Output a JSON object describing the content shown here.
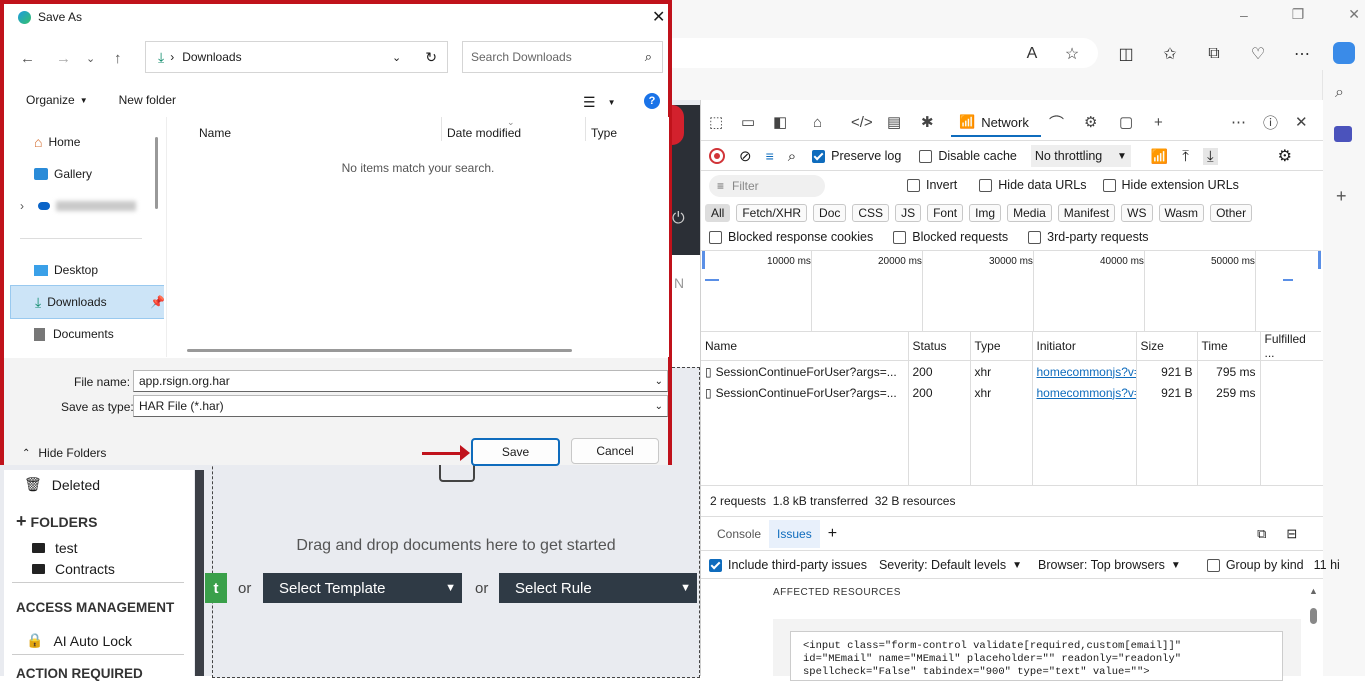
{
  "browser": {
    "toolbar_icons": [
      "read-aloud-icon",
      "favorite-star-icon",
      "split-screen-icon",
      "favorites-icon",
      "collections-icon",
      "browser-essentials-icon",
      "more-icon",
      "copilot-icon"
    ],
    "window_controls": {
      "minimize": "–",
      "restore": "❐",
      "close": "✕"
    }
  },
  "page": {
    "nav": {
      "deleted": "Deleted",
      "folders_header": "FOLDERS",
      "folders": [
        "test",
        "Contracts"
      ],
      "access_header": "ACCESS MANAGEMENT",
      "access_item": "AI Auto Lock",
      "action_header": "ACTION REQUIRED"
    },
    "drop_text": "Drag and drop documents here to get started",
    "or1": "or",
    "or2": "or",
    "select_template": "Select Template",
    "select_rule": "Select Rule",
    "green_btn_partial": "t"
  },
  "devtools": {
    "tabs": {
      "network": "Network"
    },
    "controls": {
      "preserve_log": "Preserve log",
      "disable_cache": "Disable cache",
      "throttling": "No throttling"
    },
    "filter": {
      "placeholder": "Filter",
      "invert": "Invert",
      "hide_data_urls": "Hide data URLs",
      "hide_extension_urls": "Hide extension URLs"
    },
    "type_filters": [
      "All",
      "Fetch/XHR",
      "Doc",
      "CSS",
      "JS",
      "Font",
      "Img",
      "Media",
      "Manifest",
      "WS",
      "Wasm",
      "Other"
    ],
    "blocked": {
      "blocked_cookies": "Blocked response cookies",
      "blocked_requests": "Blocked requests",
      "third_party": "3rd-party requests"
    },
    "timeline_ticks": [
      "10000 ms",
      "20000 ms",
      "30000 ms",
      "40000 ms",
      "50000 ms"
    ],
    "columns": [
      "Name",
      "Status",
      "Type",
      "Initiator",
      "Size",
      "Time",
      "Fulfilled ..."
    ],
    "rows": [
      {
        "name": "SessionContinueForUser?args=...",
        "status": "200",
        "type": "xhr",
        "initiator": "homecommonjs?v=",
        "size": "921 B",
        "time": "795 ms"
      },
      {
        "name": "SessionContinueForUser?args=...",
        "status": "200",
        "type": "xhr",
        "initiator": "homecommonjs?v=",
        "size": "921 B",
        "time": "259 ms"
      }
    ],
    "summary": "2 requests  1.8 kB transferred  32 B resources",
    "drawer": {
      "console_tab": "Console",
      "issues_tab": "Issues",
      "include_third_party": "Include third-party issues",
      "severity": "Severity: Default levels",
      "browser": "Browser: Top browsers",
      "group_by_kind": "Group by kind",
      "count_partial": "11 hi",
      "affected": "AFFECTED RESOURCES",
      "code_lines": [
        "<input class=\"form-control validate[required,custom[email]]\"",
        "id=\"MEmail\" name=\"MEmail\" placeholder=\"\" readonly=\"readonly\"",
        "spellcheck=\"False\" tabindex=\"900\" type=\"text\" value=\"\">"
      ]
    }
  },
  "dialog": {
    "title": "Save As",
    "breadcrumb": "Downloads",
    "search_placeholder": "Search Downloads",
    "organize": "Organize",
    "new_folder": "New folder",
    "nav_items": {
      "home": "Home",
      "gallery": "Gallery",
      "desktop": "Desktop",
      "downloads": "Downloads",
      "documents": "Documents"
    },
    "columns": {
      "name": "Name",
      "date_modified": "Date modified",
      "type": "Type"
    },
    "empty_message": "No items match your search.",
    "file_name_label": "File name:",
    "file_name_value": "app.rsign.org.har",
    "save_type_label": "Save as type:",
    "save_type_value": "HAR File (*.har)",
    "hide_folders": "Hide Folders",
    "save": "Save",
    "cancel": "Cancel"
  }
}
